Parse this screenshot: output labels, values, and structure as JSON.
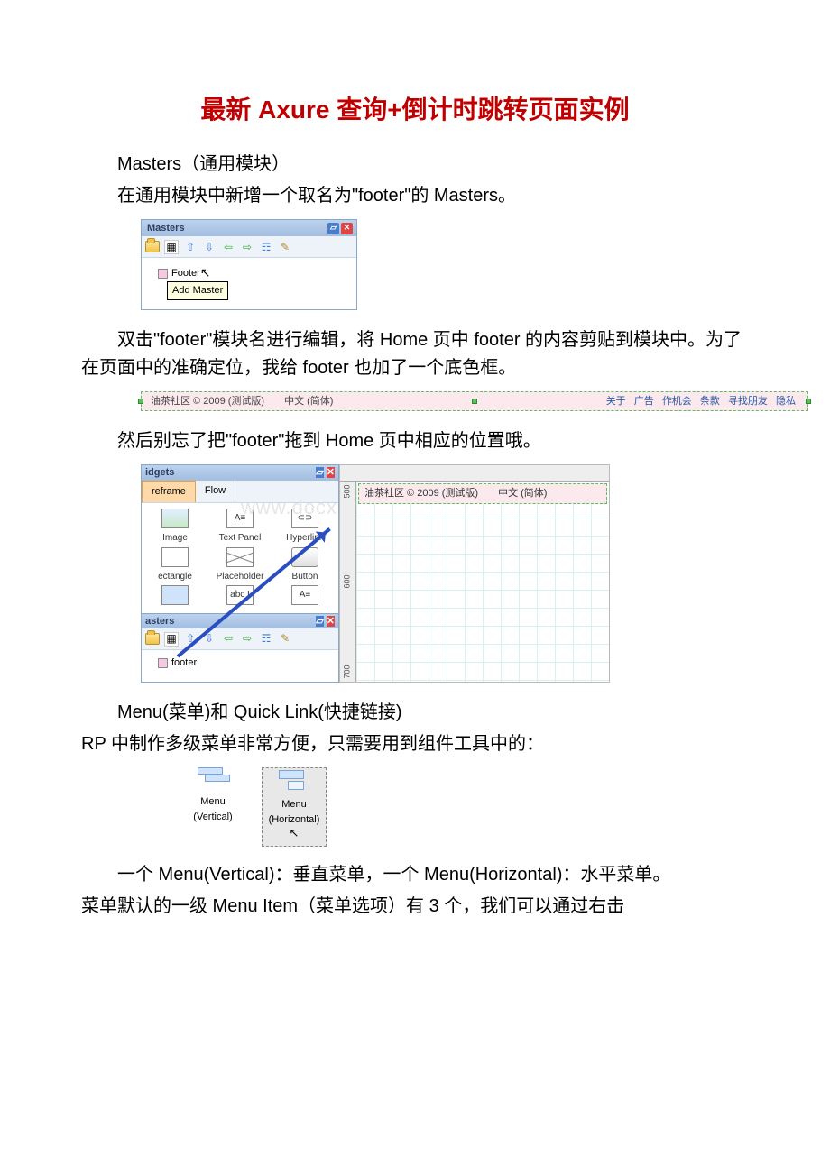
{
  "title": "最新 Axure 查询+倒计时跳转页面实例",
  "p1": "Masters（通用模块）",
  "p2": "在通用模块中新增一个取名为\"footer\"的 Masters。",
  "masters": {
    "panel_title": "Masters",
    "item": "Footer",
    "tooltip": "Add Master"
  },
  "p3": "双击\"footer\"模块名进行编辑，将 Home 页中 footer 的内容剪贴到模块中。为了在页面中的准确定位，我给 footer 也加了一个底色框。",
  "footer_strip": {
    "left": "油茶社区 © 2009 (测试版)　　中文 (简体)",
    "links": [
      "关于",
      "广告",
      "作机会",
      "条款",
      "寻找朋友",
      "隐私"
    ]
  },
  "p4": "然后别忘了把\"footer\"拖到 Home 页中相应的位置哦。",
  "widgets": {
    "title": "idgets",
    "tab_active": "reframe",
    "tab2": "Flow",
    "items": [
      "Image",
      "Text Panel",
      "Hyperlink",
      "ectangle",
      "Placeholder",
      "Button",
      "",
      "abc I",
      "A"
    ],
    "masters_title": "asters",
    "master_item": "footer"
  },
  "canvas": {
    "ruler_v": [
      "500",
      "600",
      "700"
    ],
    "footer_text": "油茶社区 © 2009 (测试版)　　中文 (简体)",
    "watermark": "www.docx.com"
  },
  "p5": "Menu(菜单)和 Quick Link(快捷链接)",
  "p6": "RP 中制作多级菜单非常方便，只需要用到组件工具中的：",
  "menu_widgets": {
    "vert": "Menu\n(Vertical)",
    "horiz": "Menu\n(Horizontal)"
  },
  "p7": "一个 Menu(Vertical)：垂直菜单，一个 Menu(Horizontal)：水平菜单。",
  "p8": "菜单默认的一级 Menu Item（菜单选项）有 3 个，我们可以通过右击"
}
